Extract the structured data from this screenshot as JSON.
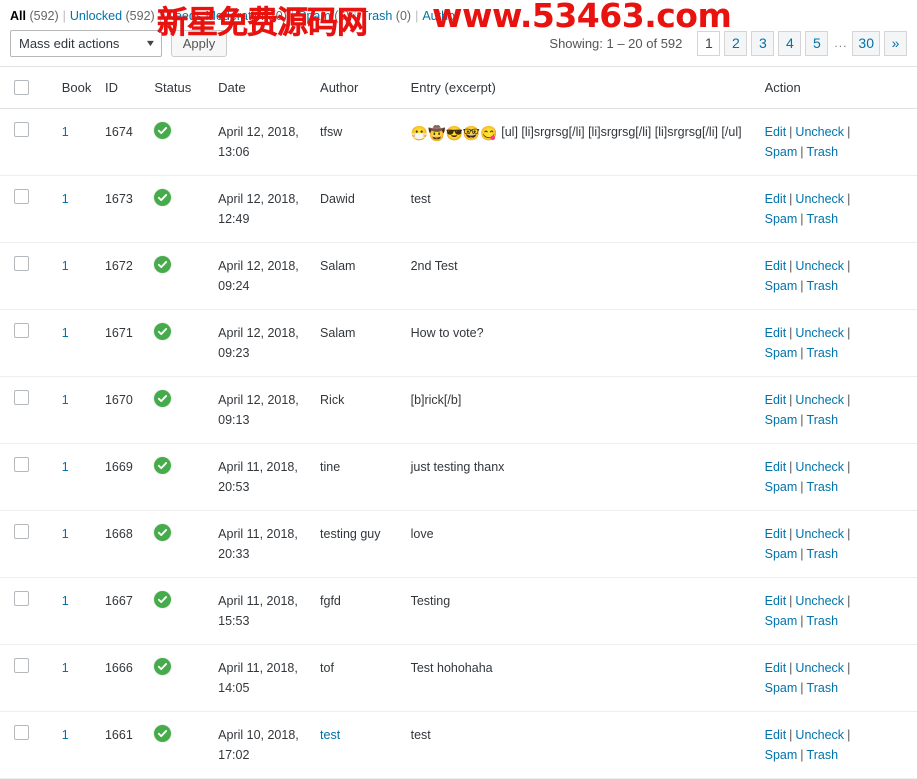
{
  "filters": {
    "all_label": "All",
    "all_count": "(592)",
    "unlocked_label": "Unlocked",
    "unlocked_count": "(592)",
    "moderation_label": "Needs Moderation",
    "moderation_count": "(0)",
    "spam_label": "Spam",
    "spam_count": "(6)",
    "trash_label": "Trash",
    "trash_count": "(0)",
    "author_label": "Author",
    "separator": "|"
  },
  "toolbar": {
    "mass_edit_value": "Mass edit actions",
    "caret_icon": "chevron-down-icon",
    "apply_label": "Apply"
  },
  "pagination": {
    "showing": "Showing: 1 – 20 of 592",
    "pages": [
      "1",
      "2",
      "3",
      "4",
      "5"
    ],
    "current_page": "1",
    "ellipsis": "...",
    "last_page": "30",
    "next_label": "»"
  },
  "table": {
    "headers": {
      "checkbox": "",
      "book": "Book",
      "id": "ID",
      "status": "Status",
      "date": "Date",
      "author": "Author",
      "entry": "Entry (excerpt)",
      "action": "Action"
    },
    "action_labels": {
      "edit": "Edit",
      "uncheck": "Uncheck",
      "spam": "Spam",
      "trash": "Trash",
      "separator": "|"
    },
    "rows": [
      {
        "book": "1",
        "id": "1674",
        "status": "approved-check-icon",
        "date": "April 12, 2018, 13:06",
        "author": "tfsw",
        "author_is_link": false,
        "emoji": "😷🤠😎🤓😋",
        "entry": "[ul] [li]srgrsg[/li] [li]srgrsg[/li] [li]srgrsg[/li] [/ul]"
      },
      {
        "book": "1",
        "id": "1673",
        "status": "approved-check-icon",
        "date": "April 12, 2018, 12:49",
        "author": "Dawid",
        "author_is_link": false,
        "emoji": "",
        "entry": "test"
      },
      {
        "book": "1",
        "id": "1672",
        "status": "approved-check-icon",
        "date": "April 12, 2018, 09:24",
        "author": "Salam",
        "author_is_link": false,
        "emoji": "",
        "entry": "2nd Test"
      },
      {
        "book": "1",
        "id": "1671",
        "status": "approved-check-icon",
        "date": "April 12, 2018, 09:23",
        "author": "Salam",
        "author_is_link": false,
        "emoji": "",
        "entry": "How to vote?"
      },
      {
        "book": "1",
        "id": "1670",
        "status": "approved-check-icon",
        "date": "April 12, 2018, 09:13",
        "author": "Rick",
        "author_is_link": false,
        "emoji": "",
        "entry": "[b]rick[/b]"
      },
      {
        "book": "1",
        "id": "1669",
        "status": "approved-check-icon",
        "date": "April 11, 2018, 20:53",
        "author": "tine",
        "author_is_link": false,
        "emoji": "",
        "entry": "just testing thanx"
      },
      {
        "book": "1",
        "id": "1668",
        "status": "approved-check-icon",
        "date": "April 11, 2018, 20:33",
        "author": "testing guy",
        "author_is_link": false,
        "emoji": "",
        "entry": "love"
      },
      {
        "book": "1",
        "id": "1667",
        "status": "approved-check-icon",
        "date": "April 11, 2018, 15:53",
        "author": "fgfd",
        "author_is_link": false,
        "emoji": "",
        "entry": "Testing"
      },
      {
        "book": "1",
        "id": "1666",
        "status": "approved-check-icon",
        "date": "April 11, 2018, 14:05",
        "author": "tof",
        "author_is_link": false,
        "emoji": "",
        "entry": "Test hohohaha"
      },
      {
        "book": "1",
        "id": "1661",
        "status": "approved-check-icon",
        "date": "April 10, 2018, 17:02",
        "author": "test",
        "author_is_link": true,
        "emoji": "",
        "entry": "test"
      }
    ]
  },
  "watermarks": {
    "chinese": "新星免费源码网",
    "url": "www.53463.com",
    "color": "#e8120f"
  }
}
